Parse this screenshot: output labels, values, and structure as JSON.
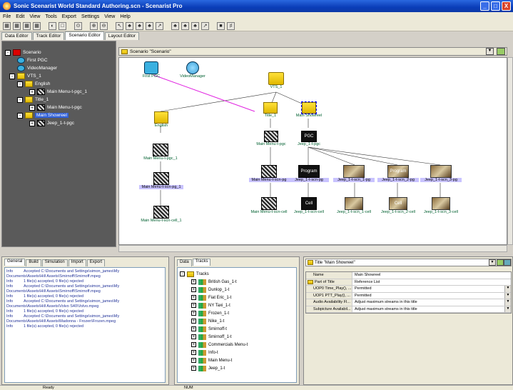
{
  "window": {
    "title": "Sonic Scenarist World Standard Authoring.scn - Scenarist Pro",
    "buttons": [
      "_",
      "□",
      "X"
    ]
  },
  "menu": [
    "File",
    "Edit",
    "View",
    "Tools",
    "Export",
    "Settings",
    "View",
    "Help"
  ],
  "main_tabs": [
    "Data Editor",
    "Track Editor",
    "Scenario Editor",
    "Layout Editor"
  ],
  "main_tab_active": "Scenario Editor",
  "tree": {
    "items": [
      {
        "label": "Scenario",
        "icon": "scenario-folder-icon",
        "toggle": "-"
      },
      {
        "label": "First PGC",
        "icon": "disc-icon",
        "toggle": ""
      },
      {
        "label": "VideoManager",
        "icon": "disc-icon",
        "toggle": ""
      },
      {
        "label": "VTS_1",
        "icon": "folder-icon",
        "toggle": "-"
      },
      {
        "label": "English",
        "icon": "language-icon",
        "toggle": "-"
      },
      {
        "label": "Main Menu-t-pgc_1",
        "icon": "clapper-icon",
        "toggle": "+"
      },
      {
        "label": "Title_1",
        "icon": "folder-icon",
        "toggle": "-"
      },
      {
        "label": "Main Menu-t-pgc",
        "icon": "clapper-icon",
        "toggle": "+"
      },
      {
        "label": "Main Showreel",
        "icon": "folder-icon",
        "toggle": "-"
      },
      {
        "label": "Jeep_1-t-pgc",
        "icon": "clapper-icon",
        "toggle": "+"
      }
    ]
  },
  "scenario_header": "Scenario \"Scenario\"",
  "canvas": {
    "nodes": {
      "first_pgc": "First PGC",
      "video_manager": "VideoManager",
      "vts_1": "VTS_1",
      "english": "English",
      "title_1": "Title_1",
      "main_showreel": "Main Showreel",
      "mm_pgc": "Main Menu-t-pgc",
      "jeep_pgc": "Jeep_1-t-pgc",
      "jeep_pgc_box": "PGC",
      "mm_pgc_1": "Main Menu-t-pgc_1",
      "mm_scn_pg": "Main Menu-t-scn-pg",
      "jeep_scn_pg": "Jeep_1-t-scn-pg",
      "jeep_scn_pg_box": "Program",
      "jeep_scn1_pg": "Jeep_1-t-scn_1-pg",
      "jeep_scn2_pg": "Jeep_1-t-scn_2-pg",
      "jeep_scn2_pg_box": "Program",
      "jeep_scn3_pg": "Jeep_1-t-scn_3-pg",
      "mm_scn_pg_1": "Main Menu-t-scn-pg_1",
      "mm_scn_cell": "Main Menu-t-scn-cell",
      "jeep_scn_cell": "Jeep_1-t-scn-cell",
      "jeep_scn_cell_box": "Cell",
      "jeep_scn1_cell": "Jeep_1-t-scn_1-cell",
      "jeep_scn2_cell": "Jeep_1-t-scn_2-cell",
      "jeep_scn2_cell_box": "Cell",
      "jeep_scn3_cell": "Jeep_1-t-scn_3-cell",
      "mm_scn_cell_1": "Main Menu-t-scn-cell_1"
    }
  },
  "log": {
    "tabs": [
      "General",
      "Build",
      "Simulation",
      "Import",
      "Export"
    ],
    "active_tab": "General",
    "lines": [
      {
        "level": "Info",
        "text": "Accepted C:\\Documents and Settings\\simon_james\\My"
      },
      {
        "level": "",
        "text": "Documents\\Assets\\Hill Assets\\Smirnoff\\Smirnoff.mpeg"
      },
      {
        "level": "Info",
        "text": "1 file(s) accepted, 0 file(s) rejected"
      },
      {
        "level": "Info",
        "text": "Accepted C:\\Documents and Settings\\simon_james\\My"
      },
      {
        "level": "",
        "text": "Documents\\Assets\\Hill Assets\\Smirnoff\\Smirnoff.mpeg"
      },
      {
        "level": "Info",
        "text": "1 file(s) accepted, 0 file(s) rejected"
      },
      {
        "level": "Info",
        "text": "Accepted C:\\Documents and Settings\\simon_james\\My"
      },
      {
        "level": "",
        "text": "Documents\\Assets\\Hill Assets\\Volvo S40\\Volvo.mpeg"
      },
      {
        "level": "Info",
        "text": "1 file(s) accepted, 0 file(s) rejected"
      },
      {
        "level": "Info",
        "text": "Accepted C:\\Documents and Settings\\simon_james\\My"
      },
      {
        "level": "",
        "text": "Documents\\Assets\\Hill Assets\\Madonna - Frozen\\Frozen.mpeg"
      },
      {
        "level": "Info",
        "text": "1 file(s) accepted, 0 file(s) rejected"
      }
    ]
  },
  "tracks": {
    "tabs": [
      "Data",
      "Tracks"
    ],
    "active_tab": "Tracks",
    "root": "Tracks",
    "items": [
      "British Gas_1-t",
      "Dunlop_1-t",
      "Fiat Eric_1-t",
      "NY Taxi_1-t",
      "Frozen_1-t",
      "Nike_1-t",
      "Smirnoff-t",
      "Smirnoff_1-t",
      "Commercials Menu-t",
      "Info-t",
      "Main Menu-t",
      "Jeep_1-t"
    ]
  },
  "properties": {
    "header": "Title \"Main Showreel\"",
    "rows": [
      {
        "key": "Name",
        "value": "Main Showreel",
        "dropdown": false,
        "indent": false
      },
      {
        "key": "Part of Title",
        "value": "Reference List",
        "dropdown": false,
        "indent": false,
        "group": true
      },
      {
        "key": "UOP0 Time_Play(), ...",
        "value": "Permitted",
        "dropdown": true,
        "indent": true
      },
      {
        "key": "UOP1 PTT_Play(), ...",
        "value": "Permitted",
        "dropdown": true,
        "indent": true
      },
      {
        "key": "Audio Availability Fl...",
        "value": "Adjust maximum streams in this title",
        "dropdown": true,
        "indent": true
      },
      {
        "key": "Subpicture Availabil...",
        "value": "Adjust maximum streams in this title",
        "dropdown": true,
        "indent": true
      }
    ]
  },
  "status": {
    "left": "Ready",
    "num": "NUM"
  }
}
